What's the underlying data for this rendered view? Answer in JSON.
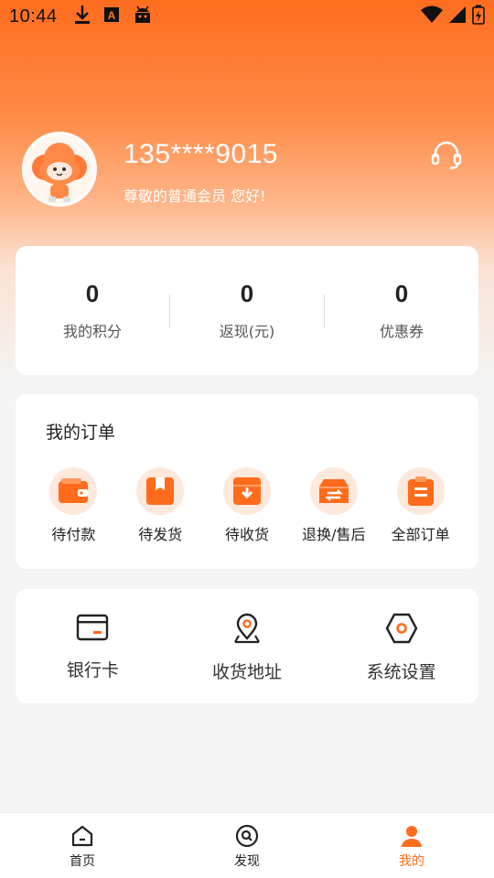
{
  "status_bar": {
    "time": "10:44",
    "icons_left": [
      "download-icon",
      "keyboard-a-icon",
      "android-icon"
    ],
    "icons_right": [
      "wifi-icon",
      "signal-icon",
      "battery-charging-icon"
    ]
  },
  "profile": {
    "phone": "135****9015",
    "greeting": "尊敬的普通会员 您好!",
    "avatar_icon": "cloud-mascot-avatar",
    "support_icon": "headset-icon"
  },
  "stats": [
    {
      "value": "0",
      "label": "我的积分"
    },
    {
      "value": "0",
      "label": "返现(元)"
    },
    {
      "value": "0",
      "label": "优惠券"
    }
  ],
  "orders": {
    "title": "我的订单",
    "items": [
      {
        "label": "待付款",
        "icon": "wallet-icon"
      },
      {
        "label": "待发货",
        "icon": "package-icon"
      },
      {
        "label": "待收货",
        "icon": "receive-box-icon"
      },
      {
        "label": "退换/售后",
        "icon": "exchange-icon"
      },
      {
        "label": "全部订单",
        "icon": "clipboard-icon"
      }
    ]
  },
  "tools": [
    {
      "label": "银行卡",
      "icon": "bank-card-icon"
    },
    {
      "label": "收货地址",
      "icon": "location-pin-icon"
    },
    {
      "label": "系统设置",
      "icon": "settings-hex-icon"
    }
  ],
  "bottom_nav": [
    {
      "label": "首页",
      "icon": "home-icon"
    },
    {
      "label": "发现",
      "icon": "discover-icon"
    },
    {
      "label": "我的",
      "icon": "profile-icon"
    }
  ],
  "colors": {
    "accent": "#ff6b1a",
    "header_gradient_top": "#ff6d1f",
    "background": "#f4f4f4",
    "icon_bg": "#fde8dc"
  }
}
